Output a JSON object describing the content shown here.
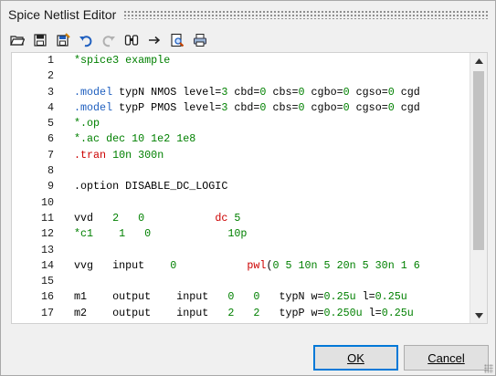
{
  "window": {
    "title": "Spice Netlist Editor"
  },
  "toolbar": {
    "buttons": [
      {
        "icon": "open-folder-icon"
      },
      {
        "icon": "save-icon"
      },
      {
        "icon": "save-as-icon"
      },
      {
        "icon": "undo-icon"
      },
      {
        "icon": "redo-icon"
      },
      {
        "icon": "find-icon"
      },
      {
        "icon": "goto-arrow-icon"
      },
      {
        "icon": "print-preview-icon"
      },
      {
        "icon": "print-icon"
      }
    ]
  },
  "colors": {
    "comment": "#008000",
    "keyword": "#1f5fbf",
    "number": "#008000",
    "function": "#cc0000",
    "text": "#000000"
  },
  "editor": {
    "lines": [
      {
        "num": "1",
        "segments": [
          {
            "t": "*spice3 example",
            "c": "comment"
          }
        ]
      },
      {
        "num": "2",
        "segments": []
      },
      {
        "num": "3",
        "segments": [
          {
            "t": ".model",
            "c": "keyword"
          },
          {
            "t": " typN NMOS level=",
            "c": "text"
          },
          {
            "t": "3",
            "c": "number"
          },
          {
            "t": " cbd=",
            "c": "text"
          },
          {
            "t": "0",
            "c": "number"
          },
          {
            "t": " cbs=",
            "c": "text"
          },
          {
            "t": "0",
            "c": "number"
          },
          {
            "t": " cgbo=",
            "c": "text"
          },
          {
            "t": "0",
            "c": "number"
          },
          {
            "t": " cgso=",
            "c": "text"
          },
          {
            "t": "0",
            "c": "number"
          },
          {
            "t": " cgd",
            "c": "text"
          }
        ]
      },
      {
        "num": "4",
        "segments": [
          {
            "t": ".model",
            "c": "keyword"
          },
          {
            "t": " typP PMOS level=",
            "c": "text"
          },
          {
            "t": "3",
            "c": "number"
          },
          {
            "t": " cbd=",
            "c": "text"
          },
          {
            "t": "0",
            "c": "number"
          },
          {
            "t": " cbs=",
            "c": "text"
          },
          {
            "t": "0",
            "c": "number"
          },
          {
            "t": " cgbo=",
            "c": "text"
          },
          {
            "t": "0",
            "c": "number"
          },
          {
            "t": " cgso=",
            "c": "text"
          },
          {
            "t": "0",
            "c": "number"
          },
          {
            "t": " cgd",
            "c": "text"
          }
        ]
      },
      {
        "num": "5",
        "segments": [
          {
            "t": "*.op",
            "c": "comment"
          }
        ]
      },
      {
        "num": "6",
        "segments": [
          {
            "t": "*.ac dec 10 1e2 1e8",
            "c": "comment"
          }
        ]
      },
      {
        "num": "7",
        "segments": [
          {
            "t": ".tran",
            "c": "function"
          },
          {
            "t": " ",
            "c": "text"
          },
          {
            "t": "10n",
            "c": "number"
          },
          {
            "t": " ",
            "c": "text"
          },
          {
            "t": "300n",
            "c": "number"
          }
        ]
      },
      {
        "num": "8",
        "segments": []
      },
      {
        "num": "9",
        "segments": [
          {
            "t": ".option DISABLE_DC_LOGIC",
            "c": "text"
          }
        ]
      },
      {
        "num": "10",
        "segments": []
      },
      {
        "num": "11",
        "segments": [
          {
            "t": "vvd   ",
            "c": "text"
          },
          {
            "t": "2",
            "c": "number"
          },
          {
            "t": "   ",
            "c": "text"
          },
          {
            "t": "0",
            "c": "number"
          },
          {
            "t": "           ",
            "c": "text"
          },
          {
            "t": "dc",
            "c": "function"
          },
          {
            "t": " ",
            "c": "text"
          },
          {
            "t": "5",
            "c": "number"
          }
        ]
      },
      {
        "num": "12",
        "segments": [
          {
            "t": "*c1    1   0            10p",
            "c": "comment"
          }
        ]
      },
      {
        "num": "13",
        "segments": []
      },
      {
        "num": "14",
        "segments": [
          {
            "t": "vvg   input    ",
            "c": "text"
          },
          {
            "t": "0",
            "c": "number"
          },
          {
            "t": "           ",
            "c": "text"
          },
          {
            "t": "pwl",
            "c": "function"
          },
          {
            "t": "(",
            "c": "text"
          },
          {
            "t": "0 5 10n 5 20n 5 30n 1 6",
            "c": "number"
          }
        ]
      },
      {
        "num": "15",
        "segments": []
      },
      {
        "num": "16",
        "segments": [
          {
            "t": "m1    output    input   ",
            "c": "text"
          },
          {
            "t": "0",
            "c": "number"
          },
          {
            "t": "   ",
            "c": "text"
          },
          {
            "t": "0",
            "c": "number"
          },
          {
            "t": "   typN w=",
            "c": "text"
          },
          {
            "t": "0.25u",
            "c": "number"
          },
          {
            "t": " l=",
            "c": "text"
          },
          {
            "t": "0.25u",
            "c": "number"
          }
        ]
      },
      {
        "num": "17",
        "segments": [
          {
            "t": "m2    output    input   ",
            "c": "text"
          },
          {
            "t": "2",
            "c": "number"
          },
          {
            "t": "   ",
            "c": "text"
          },
          {
            "t": "2",
            "c": "number"
          },
          {
            "t": "   typP w=",
            "c": "text"
          },
          {
            "t": "0.250u",
            "c": "number"
          },
          {
            "t": " l=",
            "c": "text"
          },
          {
            "t": "0.25u",
            "c": "number"
          }
        ]
      }
    ]
  },
  "footer": {
    "ok_label": "OK",
    "cancel_label": "Cancel"
  }
}
